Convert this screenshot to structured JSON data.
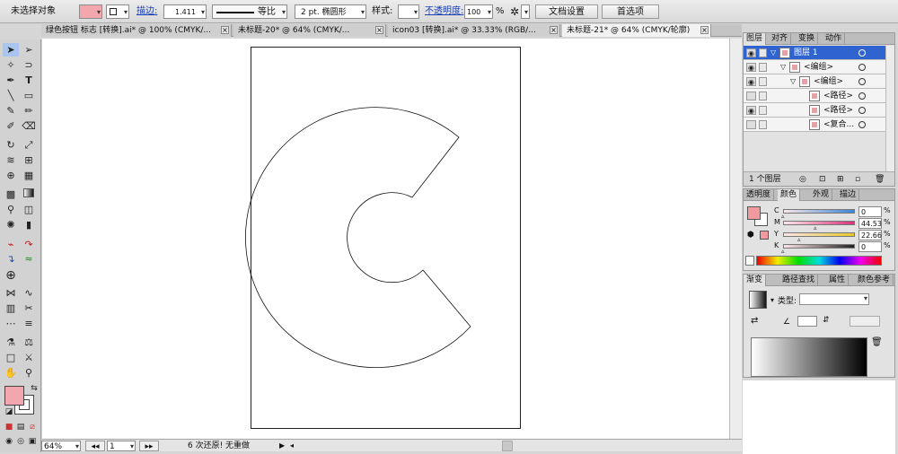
{
  "control_bar": {
    "selection_status": "未选择对象",
    "stroke_label": "描边:",
    "stroke_weight": "1.411",
    "stroke_profile": "等比",
    "brush": "2 pt. 椭圆形",
    "style_label": "样式:",
    "opacity_label": "不透明度:",
    "opacity_value": "100",
    "opacity_unit": "%",
    "doc_setup_button": "文档设置",
    "prefs_button": "首选项"
  },
  "tabs": [
    {
      "label": "绿色按钮 标志 [转换].ai* @ 100% (CMYK/..."
    },
    {
      "label": "未标题-20* @ 64% (CMYK/..."
    },
    {
      "label": "icon03 [转换].ai* @ 33.33% (RGB/..."
    },
    {
      "label": "未标题-21* @ 64% (CMYK/轮廓)"
    }
  ],
  "status_bar": {
    "zoom": "64%",
    "artboard": "1",
    "status_text": "6 次还原! 无重做"
  },
  "layers_panel": {
    "tabs": [
      "图层",
      "对齐",
      "变换",
      "动作"
    ],
    "rows": [
      {
        "name": "图层 1",
        "indent": 0,
        "visible": true,
        "selected": true
      },
      {
        "name": "<编组>",
        "indent": 1,
        "visible": true,
        "selected": false
      },
      {
        "name": "<编组>",
        "indent": 2,
        "visible": true,
        "selected": false
      },
      {
        "name": "<路径>",
        "indent": 3,
        "visible": false,
        "selected": false
      },
      {
        "name": "<路径>",
        "indent": 3,
        "visible": true,
        "selected": false
      },
      {
        "name": "<复合...",
        "indent": 3,
        "visible": false,
        "selected": false
      }
    ],
    "footer": "1 个图层"
  },
  "color_panel": {
    "tabs": [
      "透明度",
      "颜色",
      "外观",
      "描边"
    ],
    "channels": [
      {
        "name": "C",
        "value": "0",
        "color": "#3a86d8",
        "fraction": 0
      },
      {
        "name": "M",
        "value": "44.53",
        "color": "#d8337a",
        "fraction": 0.4453
      },
      {
        "name": "Y",
        "value": "22.66",
        "color": "#e8c82a",
        "fraction": 0.2266
      },
      {
        "name": "K",
        "value": "0",
        "color": "#222222",
        "fraction": 0
      }
    ],
    "fill_color": "#f09aa0"
  },
  "gradient_panel": {
    "tabs": [
      "渐变",
      "路径查找",
      "属性",
      "颜色参考"
    ],
    "type_label": "类型:"
  }
}
